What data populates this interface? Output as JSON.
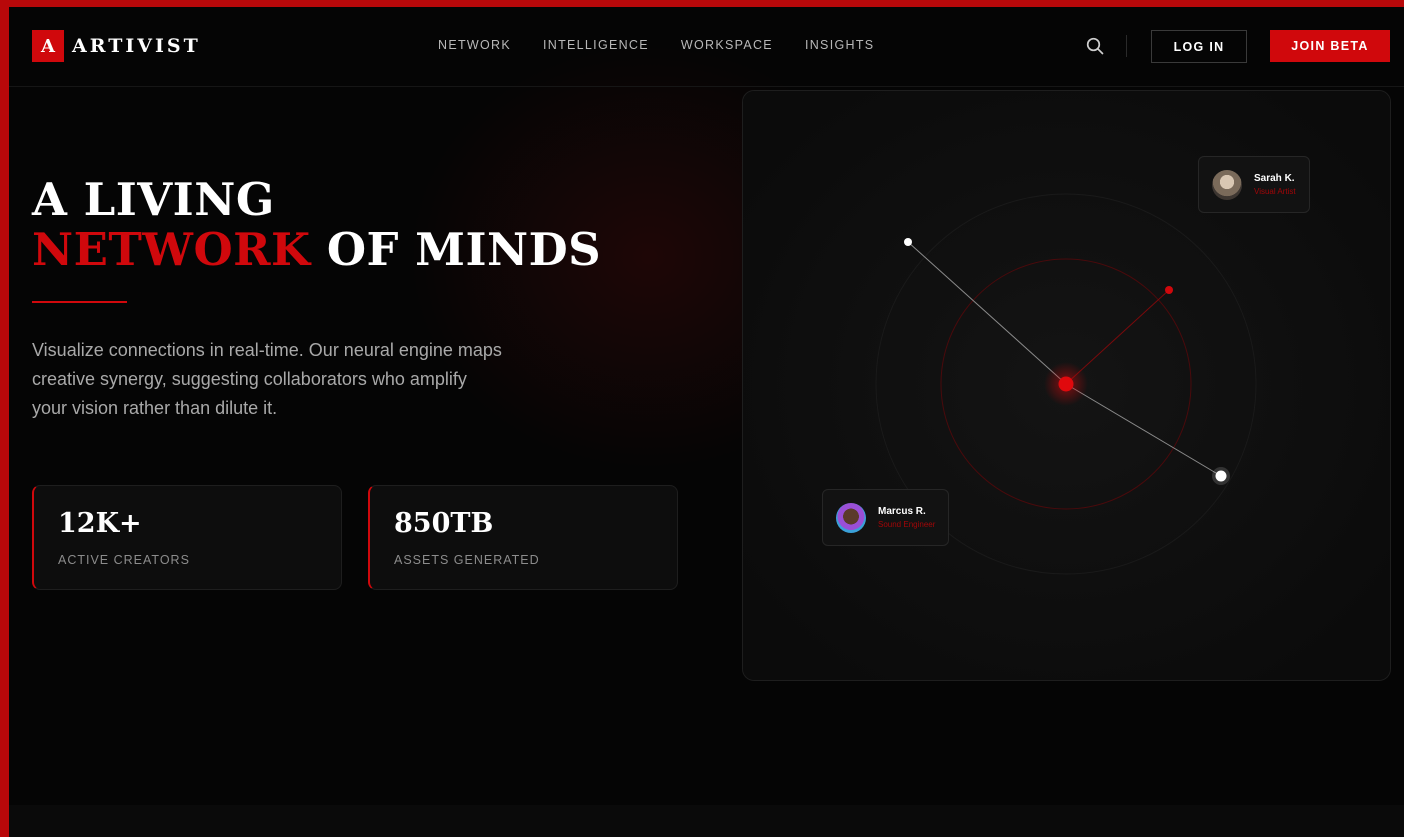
{
  "brand": {
    "mark": "A",
    "name": "ARTIVIST",
    "accent_color": "#d0080c"
  },
  "nav": {
    "items": [
      "NETWORK",
      "INTELLIGENCE",
      "WORKSPACE",
      "INSIGHTS"
    ]
  },
  "header": {
    "search_icon": "search-icon",
    "login_label": "LOG IN",
    "join_label": "JOIN BETA"
  },
  "hero": {
    "headline_line1": "A LIVING",
    "headline_accent": "NETWORK",
    "headline_rest": " OF MINDS",
    "description": "Visualize connections in real-time. Our neural engine maps creative synergy, suggesting collaborators who amplify your vision rather than dilute it."
  },
  "stats": [
    {
      "value": "12K+",
      "label": "ACTIVE CREATORS"
    },
    {
      "value": "850TB",
      "label": "ASSETS GENERATED"
    }
  ],
  "network": {
    "profiles": [
      {
        "name": "Sarah K.",
        "role": "Visual Artist"
      },
      {
        "name": "Marcus R.",
        "role": "Sound Engineer"
      }
    ]
  }
}
